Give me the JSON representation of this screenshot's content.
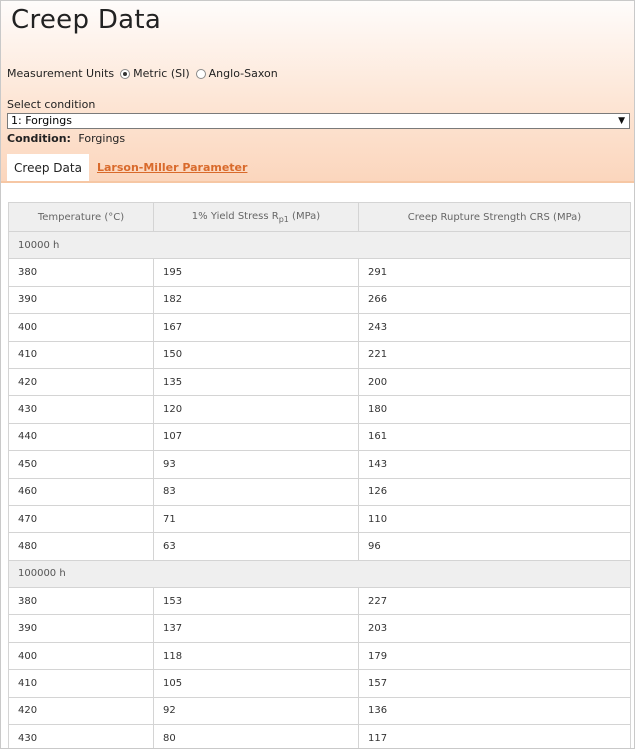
{
  "page": {
    "title": "Creep Data"
  },
  "units": {
    "label": "Measurement Units",
    "options": [
      "Metric (SI)",
      "Anglo-Saxon"
    ],
    "selected": "Metric (SI)"
  },
  "condition_select": {
    "label": "Select condition",
    "value": "1: Forgings"
  },
  "condition": {
    "label": "Condition:",
    "value": "Forgings"
  },
  "tabs": [
    {
      "label": "Creep Data",
      "active": true
    },
    {
      "label": "Larson-Miller Parameter",
      "active": false
    }
  ],
  "table": {
    "headers": {
      "temperature": "Temperature (°C)",
      "yield_pre": "1% Yield Stress R",
      "yield_sub": "p1",
      "yield_post": " (MPa)",
      "crs": "Creep Rupture Strength CRS (MPa)"
    },
    "groups": [
      {
        "label": "10000 h",
        "rows": [
          [
            "380",
            "195",
            "291"
          ],
          [
            "390",
            "182",
            "266"
          ],
          [
            "400",
            "167",
            "243"
          ],
          [
            "410",
            "150",
            "221"
          ],
          [
            "420",
            "135",
            "200"
          ],
          [
            "430",
            "120",
            "180"
          ],
          [
            "440",
            "107",
            "161"
          ],
          [
            "450",
            "93",
            "143"
          ],
          [
            "460",
            "83",
            "126"
          ],
          [
            "470",
            "71",
            "110"
          ],
          [
            "480",
            "63",
            "96"
          ]
        ]
      },
      {
        "label": "100000 h",
        "rows": [
          [
            "380",
            "153",
            "227"
          ],
          [
            "390",
            "137",
            "203"
          ],
          [
            "400",
            "118",
            "179"
          ],
          [
            "410",
            "105",
            "157"
          ],
          [
            "420",
            "92",
            "136"
          ],
          [
            "430",
            "80",
            "117"
          ]
        ]
      }
    ]
  },
  "colors": {
    "accent_link": "#d96a2b",
    "header_gradient_end": "#fbd6bd"
  }
}
